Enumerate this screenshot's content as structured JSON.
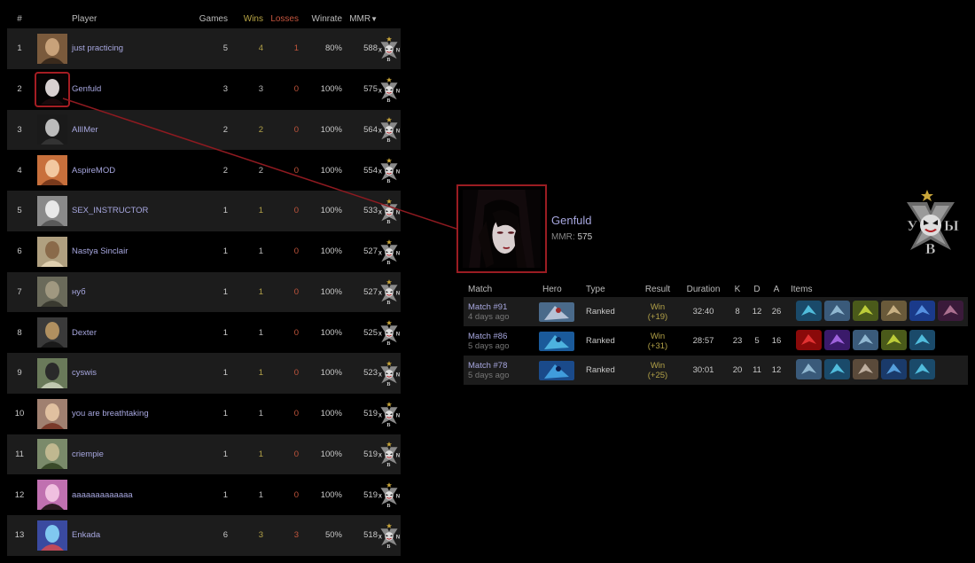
{
  "leaderboard": {
    "headers": {
      "rank": "#",
      "player": "Player",
      "games": "Games",
      "wins": "Wins",
      "losses": "Losses",
      "winrate": "Winrate",
      "mmr": "MMR",
      "sort_indicator": "▼"
    },
    "rows": [
      {
        "rank": "1",
        "player": "just practicing",
        "games": "5",
        "wins": "4",
        "losses": "1",
        "winrate": "80%",
        "mmr": "588"
      },
      {
        "rank": "2",
        "player": "Genfuld",
        "games": "3",
        "wins": "3",
        "losses": "0",
        "winrate": "100%",
        "mmr": "575"
      },
      {
        "rank": "3",
        "player": "AllIMer",
        "games": "2",
        "wins": "2",
        "losses": "0",
        "winrate": "100%",
        "mmr": "564"
      },
      {
        "rank": "4",
        "player": "AspireMOD",
        "games": "2",
        "wins": "2",
        "losses": "0",
        "winrate": "100%",
        "mmr": "554"
      },
      {
        "rank": "5",
        "player": "SEX_INSTRUCTOR",
        "games": "1",
        "wins": "1",
        "losses": "0",
        "winrate": "100%",
        "mmr": "533"
      },
      {
        "rank": "6",
        "player": "Nastya Sinclair",
        "games": "1",
        "wins": "1",
        "losses": "0",
        "winrate": "100%",
        "mmr": "527"
      },
      {
        "rank": "7",
        "player": "нуб",
        "games": "1",
        "wins": "1",
        "losses": "0",
        "winrate": "100%",
        "mmr": "527"
      },
      {
        "rank": "8",
        "player": "Dexter",
        "games": "1",
        "wins": "1",
        "losses": "0",
        "winrate": "100%",
        "mmr": "525"
      },
      {
        "rank": "9",
        "player": "cyswis",
        "games": "1",
        "wins": "1",
        "losses": "0",
        "winrate": "100%",
        "mmr": "523"
      },
      {
        "rank": "10",
        "player": "you are breathtaking",
        "games": "1",
        "wins": "1",
        "losses": "0",
        "winrate": "100%",
        "mmr": "519"
      },
      {
        "rank": "11",
        "player": "criempie",
        "games": "1",
        "wins": "1",
        "losses": "0",
        "winrate": "100%",
        "mmr": "519"
      },
      {
        "rank": "12",
        "player": "aaaaaaaaaaaaa",
        "games": "1",
        "wins": "1",
        "losses": "0",
        "winrate": "100%",
        "mmr": "519"
      },
      {
        "rank": "13",
        "player": "Enkada",
        "games": "6",
        "wins": "3",
        "losses": "3",
        "winrate": "50%",
        "mmr": "518"
      }
    ]
  },
  "profile": {
    "name": "Genfuld",
    "mmr_label": "MMR:",
    "mmr_value": "575"
  },
  "matches": {
    "headers": {
      "match": "Match",
      "hero": "Hero",
      "type": "Type",
      "result": "Result",
      "duration": "Duration",
      "k": "K",
      "d": "D",
      "a": "A",
      "items": "Items"
    },
    "rows": [
      {
        "title": "Match #91",
        "date": "4 days ago",
        "type": "Ranked",
        "result": "Win",
        "delta": "(+19)",
        "duration": "32:40",
        "k": "8",
        "d": "12",
        "a": "26"
      },
      {
        "title": "Match #86",
        "date": "5 days ago",
        "type": "Ranked",
        "result": "Win",
        "delta": "(+31)",
        "duration": "28:57",
        "k": "23",
        "d": "5",
        "a": "16"
      },
      {
        "title": "Match #78",
        "date": "5 days ago",
        "type": "Ranked",
        "result": "Win",
        "delta": "(+25)",
        "duration": "30:01",
        "k": "20",
        "d": "11",
        "a": "12"
      }
    ]
  },
  "emblem": {
    "letters_left": "У",
    "letters_right": "Ы",
    "letter_bottom": "В",
    "small_letters": "Х",
    "small_letters_right": "N"
  },
  "colors": {
    "accent_red": "#a51d23",
    "wins_yellow": "#b2a148",
    "losses_red": "#c2553c",
    "player_name": "#a7a7df",
    "row_dark": "#1c1c1c",
    "gold_star": "#c9a63a"
  }
}
